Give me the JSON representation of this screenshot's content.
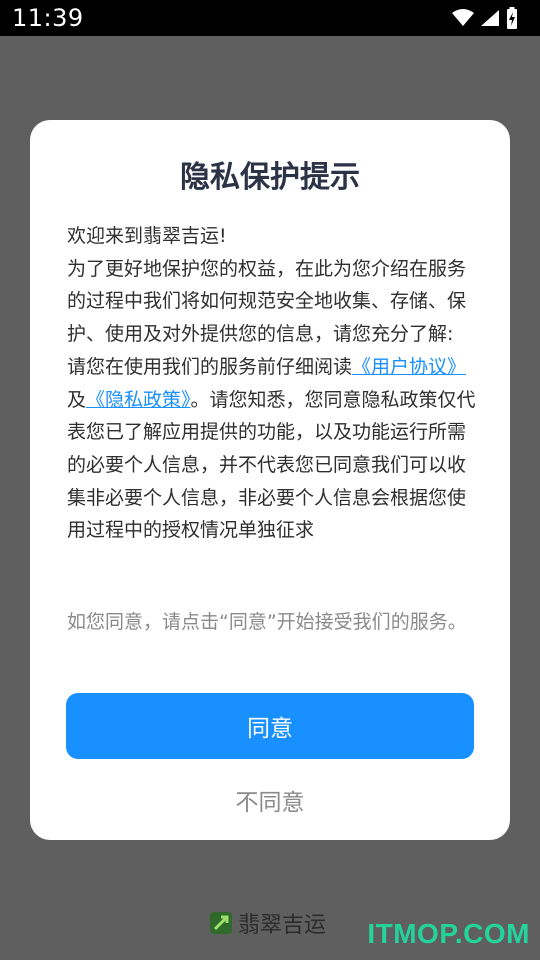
{
  "status_bar": {
    "time": "11:39"
  },
  "dialog": {
    "title": "隐私保护提示",
    "body": {
      "line_welcome": "欢迎来到翡翠吉运!",
      "intro": "为了更好地保护您的权益，在此为您介绍在服务的过程中我们将如何规范安全地收集、存储、保护、使用及对外提供您的信息，请您充分了解:",
      "read_prefix": "请您在使用我们的服务前仔细阅读",
      "user_agreement_link": "《用户协议》",
      "and": "及",
      "privacy_policy_link": "《隐私政策》",
      "read_suffix": "。请您知悉，您同意隐私政策仅代表您已了解应用提供的功能，以及功能运行所需的必要个人信息，并不代表您已同意我们可以收集非必要个人信息，非必要个人信息会根据您使用过程中的授权情况单独征求"
    },
    "consent_note": "如您同意，请点击“同意”开始接受我们的服务。",
    "agree_label": "同意",
    "disagree_label": "不同意"
  },
  "background": {
    "app_name": "翡翠吉运"
  },
  "watermark": "ITMOP.COM",
  "colors": {
    "accent": "#1890ff",
    "overlay": "#5f5f5f",
    "watermark": "#24d39a"
  }
}
